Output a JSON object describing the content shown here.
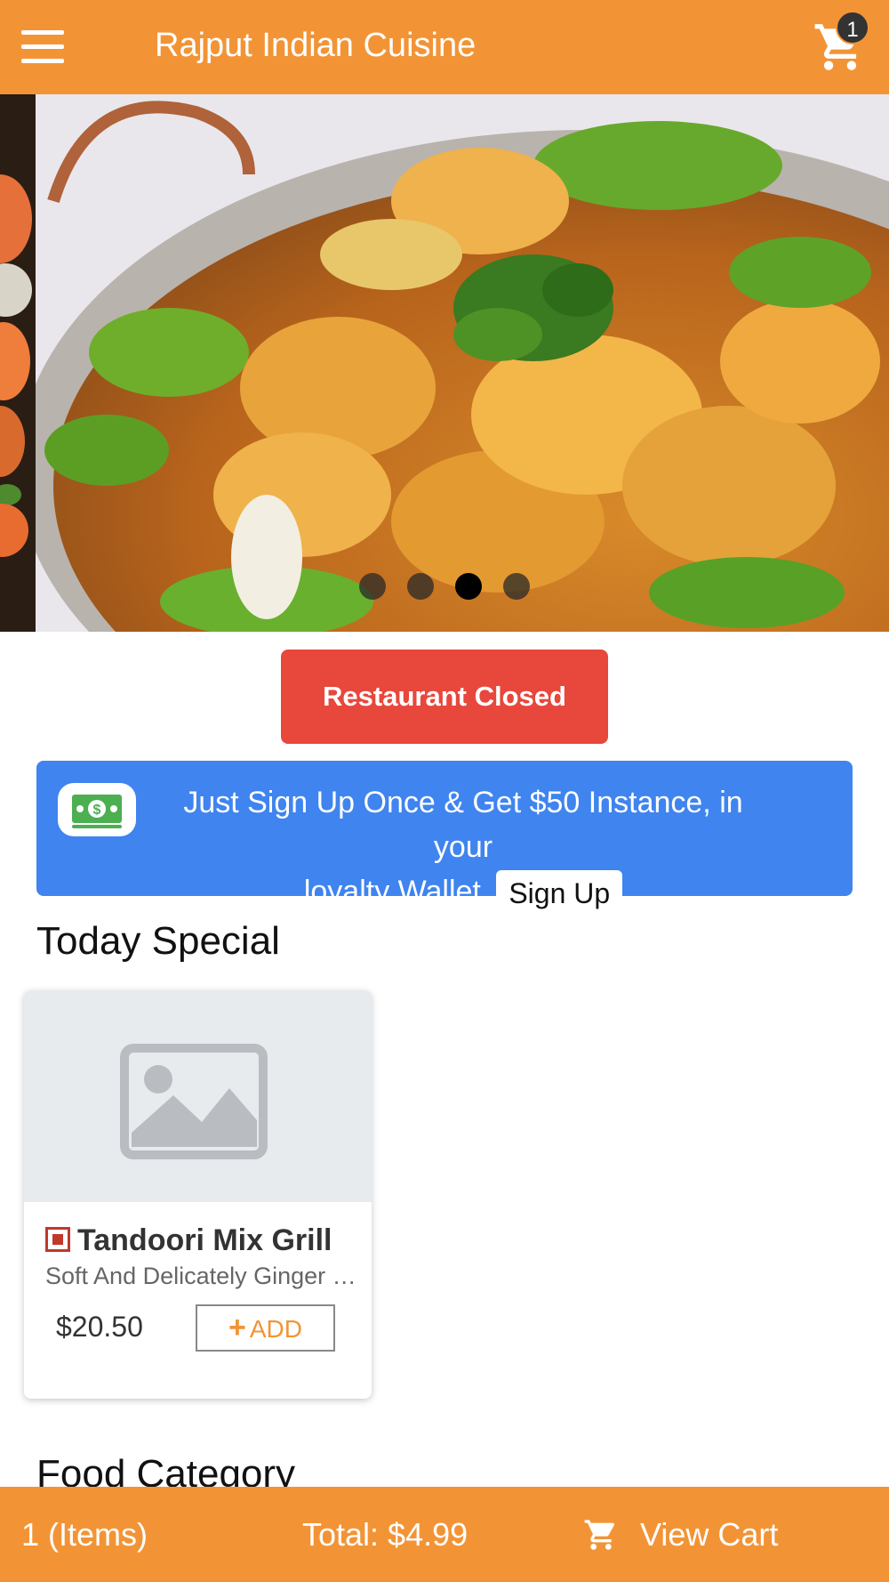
{
  "header": {
    "title": "Rajput Indian Cuisine",
    "menu_icon": "hamburger-menu-icon",
    "cart_icon": "cart-icon",
    "cart_count": "1"
  },
  "carousel": {
    "slide_count": 4,
    "active_index": 2,
    "image": "food-dish-photo"
  },
  "status": {
    "closed_label": "Restaurant Closed",
    "color": "#e8473c"
  },
  "promo": {
    "icon": "cash-icon",
    "text_line1": "Just Sign Up Once & Get $50 Instance, in your",
    "text_line2": "loyalty Wallet.",
    "signup_label": "Sign Up",
    "color": "#3f84ef"
  },
  "today_special": {
    "title": "Today Special",
    "items": [
      {
        "name": "Tandoori Mix Grill",
        "description": "Soft And Delicately Ginger Garlic Flavored",
        "price": "$20.50",
        "add_label": "ADD"
      }
    ]
  },
  "food_category": {
    "title": "Food Category"
  },
  "bottom_bar": {
    "items_label": "1 (Items)",
    "total_label": "Total: $4.99",
    "view_cart_label": "View Cart"
  },
  "colors": {
    "brand": "#f29436"
  }
}
